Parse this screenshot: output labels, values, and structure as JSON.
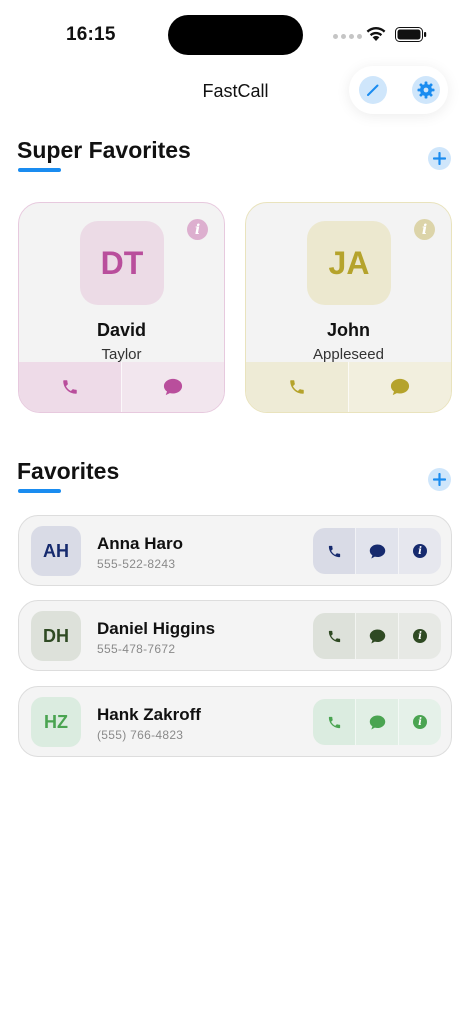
{
  "status_bar": {
    "time": "16:15"
  },
  "nav": {
    "title": "FastCall"
  },
  "super_favorites": {
    "title": "Super Favorites",
    "cards": [
      {
        "initials": "DT",
        "first_name": "David",
        "last_name": "Taylor",
        "accent": "#b94e9c",
        "tint": "#ecdbe6"
      },
      {
        "initials": "JA",
        "first_name": "John",
        "last_name": "Appleseed",
        "accent": "#b5a32c",
        "tint": "#ece8cf"
      }
    ]
  },
  "favorites": {
    "title": "Favorites",
    "items": [
      {
        "initials": "AH",
        "name": "Anna Haro",
        "phone": "555-522-8243",
        "accent": "#162a6e",
        "tint": "#d9dbe6"
      },
      {
        "initials": "DH",
        "name": "Daniel Higgins",
        "phone": "555-478-7672",
        "accent": "#2f4a23",
        "tint": "#dde1da"
      },
      {
        "initials": "HZ",
        "name": "Hank Zakroff",
        "phone": "(555) 766-4823",
        "accent": "#4aa451",
        "tint": "#dbece0"
      }
    ]
  },
  "colors": {
    "accent_blue": "#1a8cf0"
  },
  "icons": [
    "pencil-icon",
    "gear-icon",
    "plus-icon",
    "phone-icon",
    "message-icon",
    "info-icon",
    "wifi-icon",
    "battery-icon"
  ]
}
